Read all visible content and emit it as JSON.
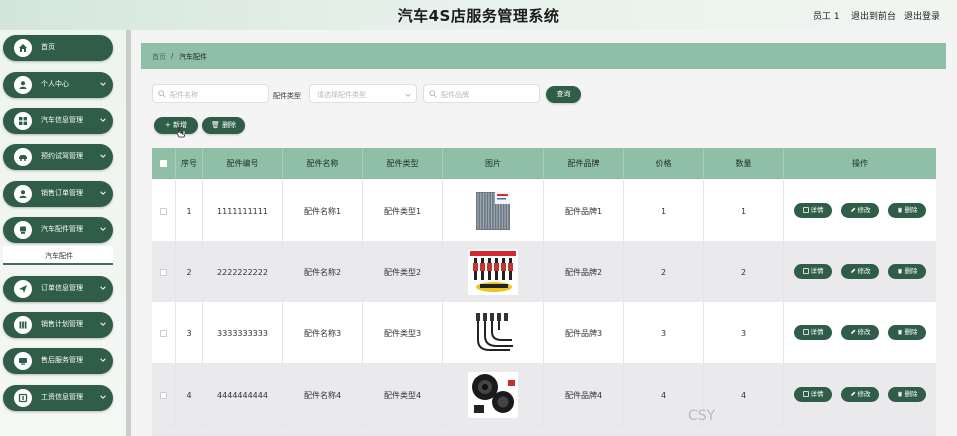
{
  "header": {
    "title": "汽车4S店服务管理系统",
    "user_label": "员工 1",
    "back_label": "退出到前台",
    "logout_label": "退出登录"
  },
  "sidebar": {
    "items": [
      {
        "label": "首页",
        "icon": "home-icon"
      },
      {
        "label": "个人中心",
        "icon": "user-icon"
      },
      {
        "label": "汽车信息管理",
        "icon": "grid-icon"
      },
      {
        "label": "预约试驾管理",
        "icon": "car-icon"
      },
      {
        "label": "销售订单管理",
        "icon": "user-icon"
      },
      {
        "label": "汽车配件管理",
        "icon": "part-icon"
      },
      {
        "label": "订单信息管理",
        "icon": "plane-icon"
      },
      {
        "label": "销售计划管理",
        "icon": "plan-icon"
      },
      {
        "label": "售后服务管理",
        "icon": "service-icon"
      },
      {
        "label": "工资信息管理",
        "icon": "wage-icon"
      }
    ],
    "active_sub": "汽车配件"
  },
  "breadcrumb": {
    "home": "首页",
    "sep": "/",
    "current": "汽车配件"
  },
  "search": {
    "name_placeholder": "配件名称",
    "type_label": "配件类型",
    "type_placeholder": "请选择配件类型",
    "brand_placeholder": "配件品牌",
    "query_label": "查询"
  },
  "toolbar": {
    "add_label": "新增",
    "delete_label": "删除"
  },
  "table": {
    "headers": [
      "序号",
      "配件编号",
      "配件名称",
      "配件类型",
      "图片",
      "配件品牌",
      "价格",
      "数量",
      "操作"
    ],
    "rows": [
      {
        "index": "1",
        "code": "1111111111",
        "name": "配件名称1",
        "type": "配件类型1",
        "brand": "配件品牌1",
        "price": "1",
        "qty": "1",
        "image": "cabin-filter"
      },
      {
        "index": "2",
        "code": "2222222222",
        "name": "配件名称2",
        "type": "配件类型2",
        "brand": "配件品牌2",
        "price": "2",
        "qty": "2",
        "image": "coilovers"
      },
      {
        "index": "3",
        "code": "3333333333",
        "name": "配件名称3",
        "type": "配件类型3",
        "brand": "配件品牌3",
        "price": "3",
        "qty": "3",
        "image": "ignition-cables"
      },
      {
        "index": "4",
        "code": "4444444444",
        "name": "配件名称4",
        "type": "配件类型4",
        "brand": "配件品牌4",
        "price": "4",
        "qty": "4",
        "image": "speakers"
      }
    ],
    "actions": {
      "detail": "详情",
      "edit": "修改",
      "delete": "删除"
    }
  },
  "colors": {
    "primary": "#2f5d48",
    "header_green": "#8fbfa6"
  },
  "watermark": "CSY"
}
